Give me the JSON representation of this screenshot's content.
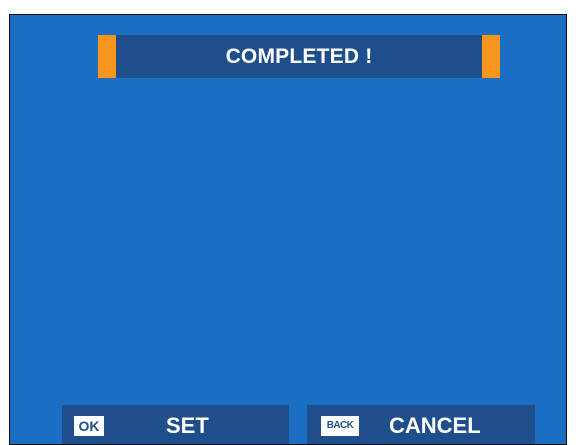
{
  "title": "COMPLETED !",
  "buttons": {
    "set": {
      "key": "OK",
      "label": "SET"
    },
    "cancel": {
      "key": "BACK",
      "label": "CANCEL"
    }
  },
  "colors": {
    "background": "#1a6ec4",
    "bar": "#1e4f8c",
    "accent": "#f6961d",
    "text": "#ffffff"
  }
}
